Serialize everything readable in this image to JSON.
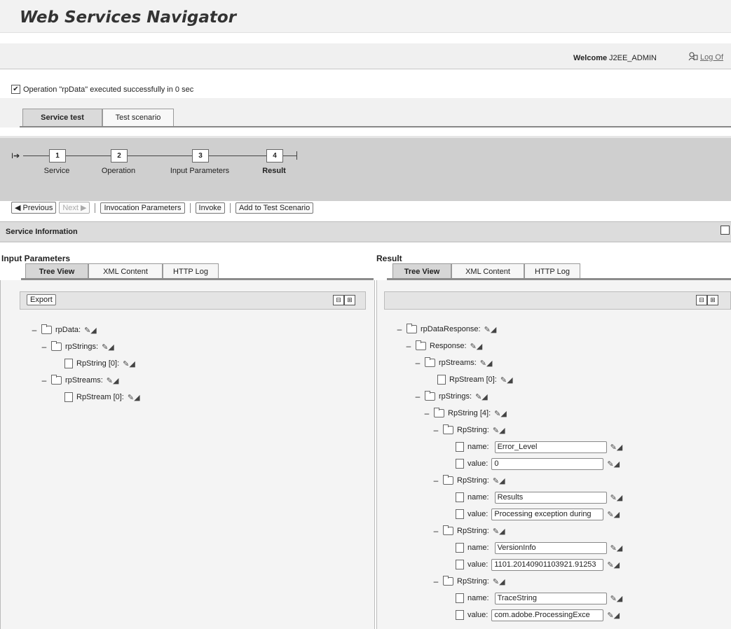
{
  "app": {
    "title": "Web Services Navigator"
  },
  "header": {
    "welcome": "Welcome",
    "user": "J2EE_ADMIN",
    "logoff": "Log Of"
  },
  "status": {
    "message": "Operation \"rpData\" executed successfully in 0 sec"
  },
  "top_tabs": [
    "Service test",
    "Test scenario"
  ],
  "steps": [
    {
      "num": "1",
      "label": "Service"
    },
    {
      "num": "2",
      "label": "Operation"
    },
    {
      "num": "3",
      "label": "Input Parameters"
    },
    {
      "num": "4",
      "label": "Result"
    }
  ],
  "toolbar_buttons": {
    "previous": "Previous",
    "next": "Next",
    "invocation": "Invocation Parameters",
    "invoke": "Invoke",
    "add": "Add to Test Scenario"
  },
  "service_info": "Service Information",
  "input": {
    "title": "Input Parameters",
    "tabs": [
      "Tree View",
      "XML Content",
      "HTTP Log"
    ],
    "export": "Export",
    "tree": [
      {
        "level": 0,
        "type": "folder",
        "label": "rpData:"
      },
      {
        "level": 1,
        "type": "folder",
        "label": "rpStrings:"
      },
      {
        "level": 2,
        "type": "doc",
        "label": "RpString [0]:"
      },
      {
        "level": 1,
        "type": "folder",
        "label": "rpStreams:"
      },
      {
        "level": 2,
        "type": "doc",
        "label": "RpStream [0]:"
      }
    ]
  },
  "result": {
    "title": "Result",
    "tabs": [
      "Tree View",
      "XML Content",
      "HTTP Log"
    ],
    "tree": [
      {
        "level": 0,
        "type": "folder",
        "label": "rpDataResponse:"
      },
      {
        "level": 1,
        "type": "folder",
        "label": "Response:"
      },
      {
        "level": 2,
        "type": "folder",
        "label": "rpStreams:"
      },
      {
        "level": 3,
        "type": "doc",
        "label": "RpStream [0]:"
      },
      {
        "level": 2,
        "type": "folder",
        "label": "rpStrings:"
      },
      {
        "level": 3,
        "type": "folder",
        "label": "RpString [4]:"
      },
      {
        "level": 4,
        "type": "folder",
        "label": "RpString:"
      },
      {
        "level": 5,
        "type": "doc",
        "label": "name:",
        "value": "Error_Level"
      },
      {
        "level": 5,
        "type": "doc",
        "label": "value:",
        "value": "0"
      },
      {
        "level": 4,
        "type": "folder",
        "label": "RpString:"
      },
      {
        "level": 5,
        "type": "doc",
        "label": "name:",
        "value": "Results"
      },
      {
        "level": 5,
        "type": "doc",
        "label": "value:",
        "value": "Processing exception during"
      },
      {
        "level": 4,
        "type": "folder",
        "label": "RpString:"
      },
      {
        "level": 5,
        "type": "doc",
        "label": "name:",
        "value": "VersionInfo"
      },
      {
        "level": 5,
        "type": "doc",
        "label": "value:",
        "value": "1101.20140901103921.91253"
      },
      {
        "level": 4,
        "type": "folder",
        "label": "RpString:"
      },
      {
        "level": 5,
        "type": "doc",
        "label": "name:",
        "value": "TraceString"
      },
      {
        "level": 5,
        "type": "doc",
        "label": "value:",
        "value": " com.adobe.ProcessingExce"
      }
    ]
  }
}
